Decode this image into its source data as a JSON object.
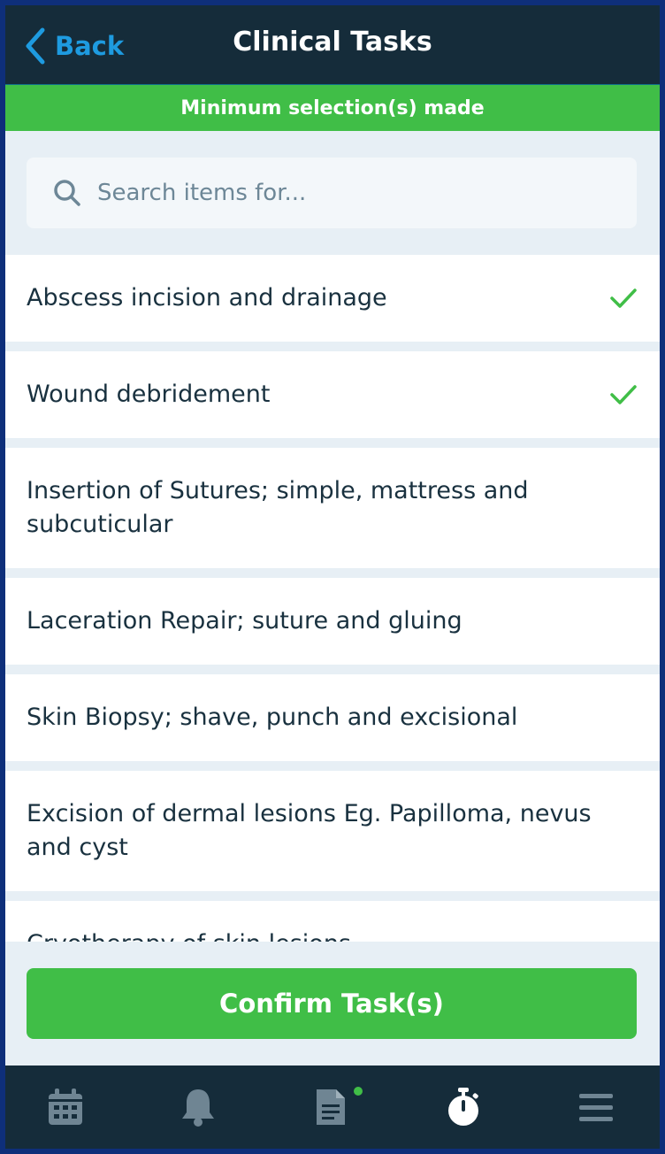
{
  "header": {
    "back_label": "Back",
    "title": "Clinical Tasks"
  },
  "banner": {
    "text": "Minimum selection(s) made",
    "color": "#40be47"
  },
  "search": {
    "placeholder": "Search items for...",
    "value": "",
    "icon": "search-icon"
  },
  "items": [
    {
      "label": "Abscess incision and drainage",
      "selected": true
    },
    {
      "label": "Wound debridement",
      "selected": true
    },
    {
      "label": "Insertion of Sutures; simple, mattress and subcuticular",
      "selected": false
    },
    {
      "label": "Laceration Repair; suture and gluing",
      "selected": false
    },
    {
      "label": "Skin Biopsy; shave, punch and excisional",
      "selected": false
    },
    {
      "label": "Excision of dermal lesions Eg. Papilloma, nevus and cyst",
      "selected": false
    },
    {
      "label": "Cryotherapy of skin lesions",
      "selected": false
    }
  ],
  "footer": {
    "confirm_label": "Confirm Task(s)"
  },
  "tabbar": {
    "tabs": [
      {
        "icon": "calendar-icon",
        "active": false
      },
      {
        "icon": "bell-icon",
        "active": false
      },
      {
        "icon": "document-icon",
        "active": false,
        "badge": true
      },
      {
        "icon": "stopwatch-icon",
        "active": true
      },
      {
        "icon": "menu-icon",
        "active": false
      }
    ]
  },
  "colors": {
    "header_bg": "#152c3a",
    "accent_blue": "#1e9be0",
    "success_green": "#40be47",
    "text_dark": "#19313f",
    "page_bg": "#e7eff5"
  }
}
